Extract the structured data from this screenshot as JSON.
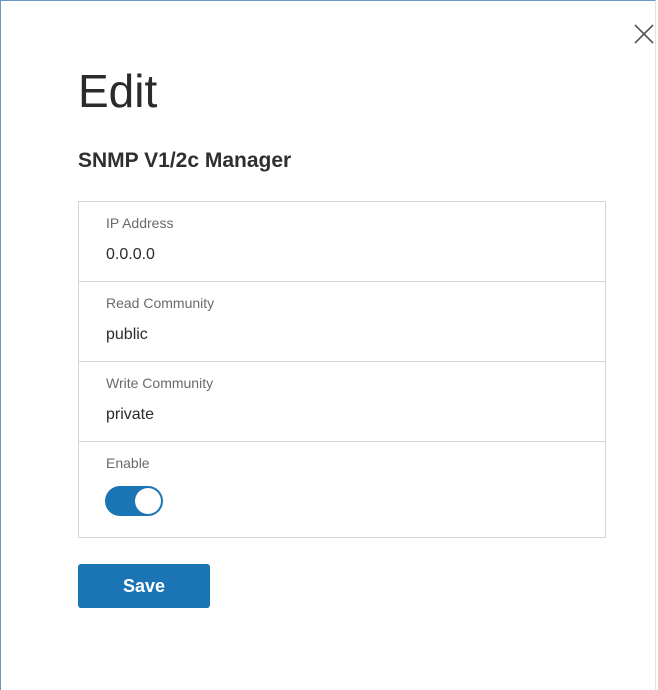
{
  "dialog": {
    "title": "Edit",
    "subtitle": "SNMP V1/2c Manager",
    "close_icon": "close-icon"
  },
  "form": {
    "ip_address": {
      "label": "IP Address",
      "value": "0.0.0.0"
    },
    "read_community": {
      "label": "Read Community",
      "value": "public"
    },
    "write_community": {
      "label": "Write Community",
      "value": "private"
    },
    "enable": {
      "label": "Enable",
      "state": "on"
    }
  },
  "actions": {
    "save_label": "Save"
  },
  "colors": {
    "accent": "#1b74b4",
    "border": "#cfd6dd",
    "dialog_border": "#6b97c7"
  }
}
